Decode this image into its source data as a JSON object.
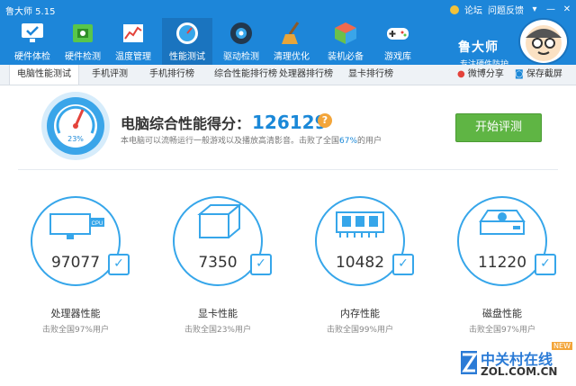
{
  "titlebar": {
    "title": "鲁大师 5.15",
    "links": [
      "论坛",
      "问题反馈"
    ],
    "win_icons": [
      "menu-icon",
      "minimize-icon",
      "close-icon"
    ]
  },
  "toolbar": {
    "items": [
      {
        "label": "硬件体检",
        "icon": "monitor-check-icon"
      },
      {
        "label": "硬件检测",
        "icon": "circuit-board-icon"
      },
      {
        "label": "温度管理",
        "icon": "temperature-chart-icon"
      },
      {
        "label": "性能测试",
        "icon": "speedometer-icon"
      },
      {
        "label": "驱动检测",
        "icon": "gear-chip-icon"
      },
      {
        "label": "清理优化",
        "icon": "broom-icon"
      },
      {
        "label": "装机必备",
        "icon": "cube-icon"
      },
      {
        "label": "游戏库",
        "icon": "gamepad-icon"
      }
    ],
    "brand_name": "鲁大师",
    "brand_slogan": "专注硬件防护"
  },
  "tabs": {
    "items": [
      "电脑性能测试",
      "手机评测",
      "手机排行榜",
      "综合性能排行榜",
      "处理器排行榜",
      "显卡排行榜"
    ],
    "active": "电脑性能测试",
    "share": "微博分享",
    "save": "保存截屏"
  },
  "score": {
    "title": "电脑综合性能得分：",
    "value": "126129",
    "desc_prefix": "本电脑可以流畅运行一般游戏以及播放高清影音。击败了全国",
    "desc_pct": "67%",
    "desc_suffix": "的用户",
    "gauge_text": "23%",
    "start_button": "开始评测"
  },
  "cards": [
    {
      "value": "97077",
      "name": "处理器性能",
      "sub": "击败全国97%用户",
      "icon": "cpu-icon"
    },
    {
      "value": "7350",
      "name": "显卡性能",
      "sub": "击败全国23%用户",
      "icon": "gpu-box-icon"
    },
    {
      "value": "10482",
      "name": "内存性能",
      "sub": "击败全国99%用户",
      "icon": "memory-icon"
    },
    {
      "value": "11220",
      "name": "磁盘性能",
      "sub": "击败全国97%用户",
      "icon": "disk-icon"
    }
  ],
  "watermark": {
    "cn": "中关村在线",
    "en": "ZOL.COM.CN",
    "badge": "NEW"
  },
  "colors": {
    "header_blue": "#1d86d9",
    "accent_blue": "#36a6ea",
    "score_blue": "#1a88d8",
    "start_green": "#5fb544"
  }
}
